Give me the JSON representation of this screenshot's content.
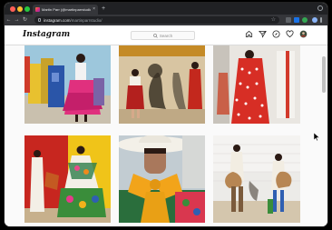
{
  "browser": {
    "tab_title": "Martin Parr (@martinparrstudio)",
    "tab_close": "×",
    "new_tab": "+",
    "url_host": "instagram.com",
    "url_path": "/martinparrstudio/",
    "back": "←",
    "forward": "→",
    "reload": "↻",
    "bookmark": "☆"
  },
  "instagram": {
    "logo": "Instagram",
    "search_placeholder": "Search",
    "nav_icons": [
      "home-icon",
      "direct-icon",
      "explore-icon",
      "activity-icon",
      "profile-avatar"
    ]
  },
  "feed": {
    "posts": [
      {
        "subject": "woman in pink ruffled skirt by gas pumps"
      },
      {
        "subject": "woman in red dress with shadow on wall"
      },
      {
        "subject": "woman in red and white polka dot dress"
      },
      {
        "subject": "women in white and embroidered dresses on yellow wall"
      },
      {
        "subject": "woman in white hat with big yellow bow"
      },
      {
        "subject": "women in white outfits holding guitars"
      }
    ]
  },
  "colors": {
    "instagram_gradient": [
      "#f58529",
      "#dd2a7b",
      "#8134af"
    ],
    "chrome_dark": "#202124",
    "chrome_toolbar": "#35363a"
  }
}
